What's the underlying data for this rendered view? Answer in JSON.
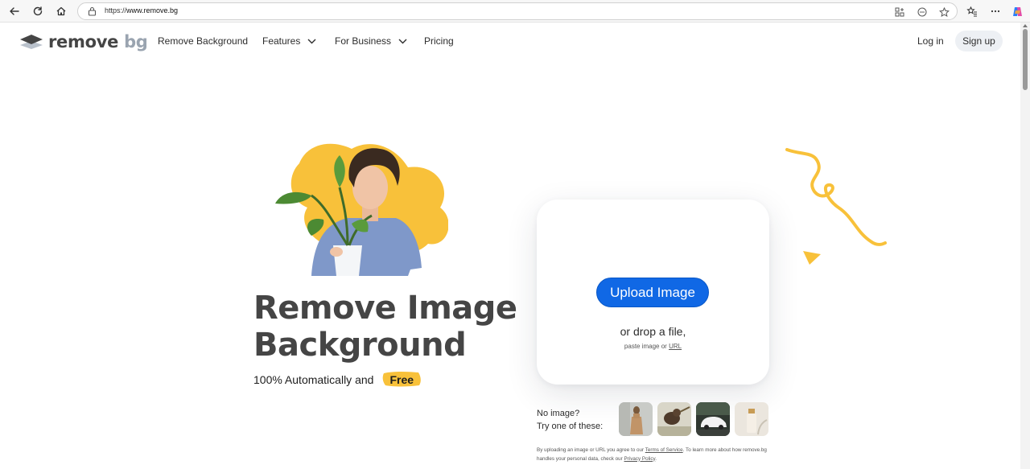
{
  "browser": {
    "url_scheme": "https://",
    "url_host": "www.remove.bg"
  },
  "header": {
    "logo_main": "remove",
    "logo_accent": "bg",
    "nav": [
      {
        "label": "Remove Background"
      },
      {
        "label": "Features"
      },
      {
        "label": "For Business"
      },
      {
        "label": "Pricing"
      }
    ],
    "login": "Log in",
    "signup": "Sign up"
  },
  "hero": {
    "title_line1": "Remove Image",
    "title_line2": "Background",
    "subtitle": "100% Automatically and",
    "badge": "Free"
  },
  "upload": {
    "button": "Upload Image",
    "drop": "or drop a file,",
    "paste_prefix": "paste image or ",
    "paste_link": "URL"
  },
  "samples": {
    "line1": "No image?",
    "line2": "Try one of these:"
  },
  "legal": {
    "t1": "By uploading an image or URL you agree to our ",
    "tos": "Terms of Service",
    "t2": ". To learn more about how remove.bg handles your personal data, check our ",
    "privacy": "Privacy Policy",
    "t3": "."
  },
  "colors": {
    "accent_blue": "#1068e5",
    "accent_yellow": "#f8c13a",
    "text_dark": "#454545"
  }
}
